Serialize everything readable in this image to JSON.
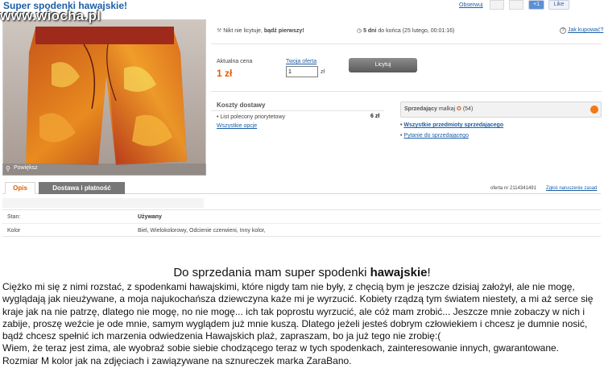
{
  "header": {
    "title": "Super spodenki hawajskie!",
    "watch_label": "Obserwuj",
    "plus_label": "+1",
    "like_label": "Like",
    "watermark": "www.wiocha.pl"
  },
  "gallery": {
    "zoom_label": "Powiększ"
  },
  "summary": {
    "nobody_bid": "Nikt nie licytuje,",
    "be_first": "bądź pierwszy!",
    "days_left": "5 dni",
    "until_end": "do końca (25 lutego, 00:01:16)",
    "how_to_buy": "Jak kupować?"
  },
  "bidding": {
    "current_price_label": "Aktualna cena",
    "current_price": "1 zł",
    "your_offer_label": "Twoja oferta",
    "offer_value": "1",
    "currency": "zł",
    "bid_button": "Licytuj"
  },
  "shipping": {
    "title": "Koszty dostawy",
    "option_name": "List polecony priorytetowy",
    "option_price": "6 zł",
    "all_options": "Wszystkie opcje"
  },
  "seller": {
    "label": "Sprzedający",
    "name": "malkaj",
    "rating": "(54)",
    "all_items": "Wszystkie przedmioty sprzedającego",
    "ask_seller": "Pytanie do sprzedającego"
  },
  "tabs": {
    "description": "Opis",
    "shipping_payment": "Dostawa i płatność"
  },
  "offer_meta": {
    "offer_number": "oferta nr 2114341491",
    "report": "Zgłoś naruszenie zasad"
  },
  "attributes": {
    "rows": [
      {
        "label": "Stan:",
        "value": "Używany"
      },
      {
        "label": "Kolor",
        "value": "Biel, Wielokolorowy, Odcienie czerwieni, Inny kolor,"
      }
    ]
  },
  "description": {
    "heading_prefix": "Do sprzedania mam super spodenki ",
    "heading_bold": "hawajskie",
    "heading_suffix": "!",
    "paragraph1": "Ciężko mi się z nimi rozstać, z spodenkami hawajskimi, które nigdy tam nie były, z chęcią bym je jeszcze dzisiaj założył, ale nie mogę, wyglądają jak nieużywane, a moja najukochańsza dziewczyna każe mi je wyrzucić. Kobiety rządzą tym światem niestety, a mi aż serce się kraje jak na nie patrzę, dlatego nie mogę, no nie mogę... ich tak poprostu wyrzucić, ale cóż mam zrobić... Jeszcze mnie zobaczy w nich i zabije, proszę weźcie je ode mnie, samym wyglądem już mnie kuszą. Dlatego jeżeli jesteś dobrym człowiekiem i chcesz je dumnie nosić, bądź chcesz spełnić ich marzenia odwiedzenia Hawajskich plaż, zapraszam, bo ja już tego nie zrobię:(",
    "paragraph2": "Wiem, że teraz jest zima, ale wyobraź sobie siebie chodzącego teraz w tych spodenkach, zainteresowanie innych, gwarantowane.",
    "paragraph3": "Rozmiar M kolor jak na zdjęciach i zawiązywane na sznureczek marka ZaraBano."
  },
  "colors": {
    "link_blue": "#1a5fa8",
    "price_orange": "#e35b00",
    "tab_grey": "#777777"
  }
}
